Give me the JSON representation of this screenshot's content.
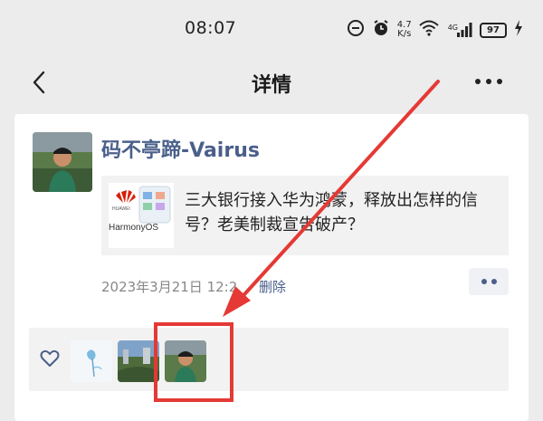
{
  "status_bar": {
    "time": "08:07",
    "net_speed_value": "4.7",
    "net_speed_unit": "K/s",
    "network_type": "4G",
    "battery_level": "97"
  },
  "header": {
    "title": "详情",
    "back_icon": "chevron-left-icon",
    "more_icon": "more-horizontal-icon"
  },
  "post": {
    "author": "码不亭蹄-Vairus",
    "link_title": "三大银行接入华为鸿蒙，释放出怎样的信号？老美制裁宣告破产？",
    "link_thumb_brand": "HUAWEI",
    "link_thumb_text": "HarmonyOS",
    "date": "2023年3月21日 12:2",
    "delete_label": "删除"
  },
  "likes": {
    "icon": "heart-icon",
    "avatars": [
      "like-avatar-1",
      "like-avatar-2",
      "like-avatar-3"
    ]
  },
  "colors": {
    "accent": "#4a5f8a",
    "highlight": "#e53935",
    "background": "#ececec"
  }
}
